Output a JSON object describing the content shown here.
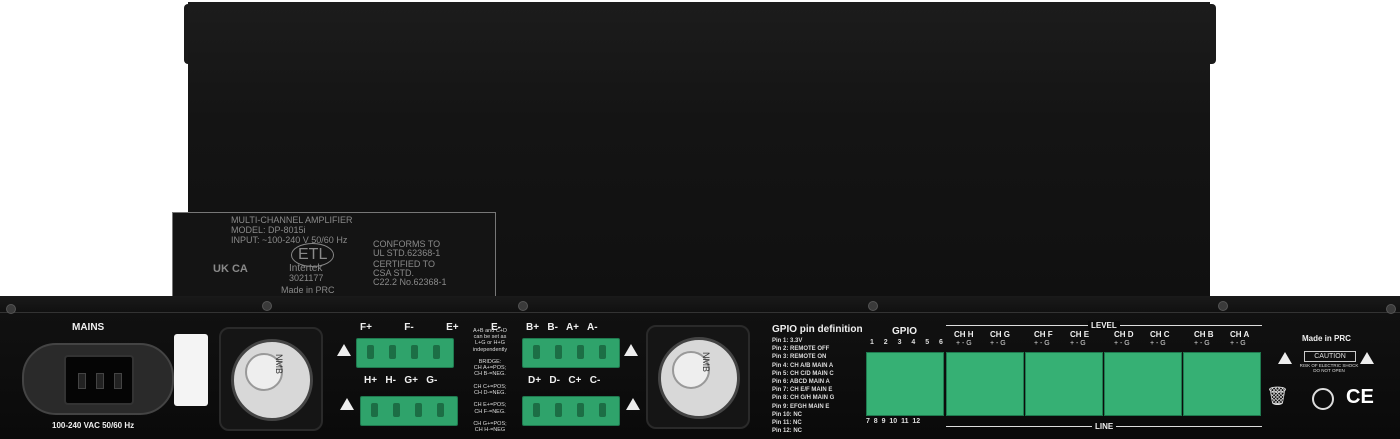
{
  "label_plate": {
    "line1": "MULTI-CHANNEL AMPLIFIER",
    "line2": "MODEL: DP-8015i",
    "line3": "INPUT:  ~100-240 V  50/60 Hz",
    "etl": "ETL",
    "conforms1": "CONFORMS TO",
    "conforms2": "UL STD.62368-1",
    "certified1": "CERTIFIED TO",
    "certified2": "CSA STD.",
    "certified3": "C22.2 No.62368-1",
    "ukca": "UK CA",
    "intertek": "Intertek",
    "intertek_no": "3021177",
    "made_in": "Made in PRC"
  },
  "mains": {
    "title": "MAINS",
    "rating": "100-240 VAC  50/60 Hz"
  },
  "fans": {
    "brand": "NMB"
  },
  "outputs": {
    "top_left": [
      "F+",
      "F-",
      "E+",
      "E-"
    ],
    "bottom_left": [
      "H+",
      "H-",
      "G+",
      "G-"
    ],
    "top_right": [
      "B+",
      "B-",
      "A+",
      "A-"
    ],
    "bottom_right": [
      "D+",
      "D-",
      "C+",
      "C-"
    ],
    "bridge_note": [
      "A+B and C+D",
      "can be set as",
      "L+G or H+G",
      "independently",
      "",
      "BRIDGE:",
      "CH A+=POS;",
      "CH B-=NEG.",
      "",
      "CH C+=POS;",
      "CH D-=NEG.",
      "",
      "CH E+=POS;",
      "CH F-=NEG.",
      "",
      "CH G+=POS;",
      "CH H-=NEG"
    ]
  },
  "gpio_definition": {
    "title": "GPIO pin definition",
    "pins": [
      "Pin 1: 3.3V",
      "Pin 2: REMOTE OFF",
      "Pin 3: REMOTE ON",
      "Pin 4: CH A/B MAIN A",
      "Pin 5: CH C/D MAIN C",
      "Pin 6: ABCD MAIN A",
      "Pin 7: CH E/F MAIN E",
      "Pin 8: CH G/H MAIN G",
      "Pin 9: EFGH MAIN E",
      "Pin 10: NC",
      "Pin 11: NC",
      "Pin 12: NC"
    ]
  },
  "gpio": {
    "title": "GPIO",
    "top_numbers": [
      "1",
      "2",
      "3",
      "4",
      "5",
      "6"
    ],
    "bottom_numbers": [
      "7",
      "8",
      "9",
      "10",
      "11",
      "12"
    ]
  },
  "level": {
    "title": "LEVEL",
    "channels": [
      "CH H",
      "CH G",
      "CH F",
      "CH E",
      "CH D",
      "CH C",
      "CH B",
      "CH A"
    ],
    "pin_marks": "+ - G",
    "line_title": "LINE"
  },
  "right_side": {
    "made_in": "Made in PRC",
    "caution": "CAUTION",
    "caution_sub": "RISK OF ELECTRIC SHOCK DO NOT OPEN",
    "ce": "CE"
  }
}
